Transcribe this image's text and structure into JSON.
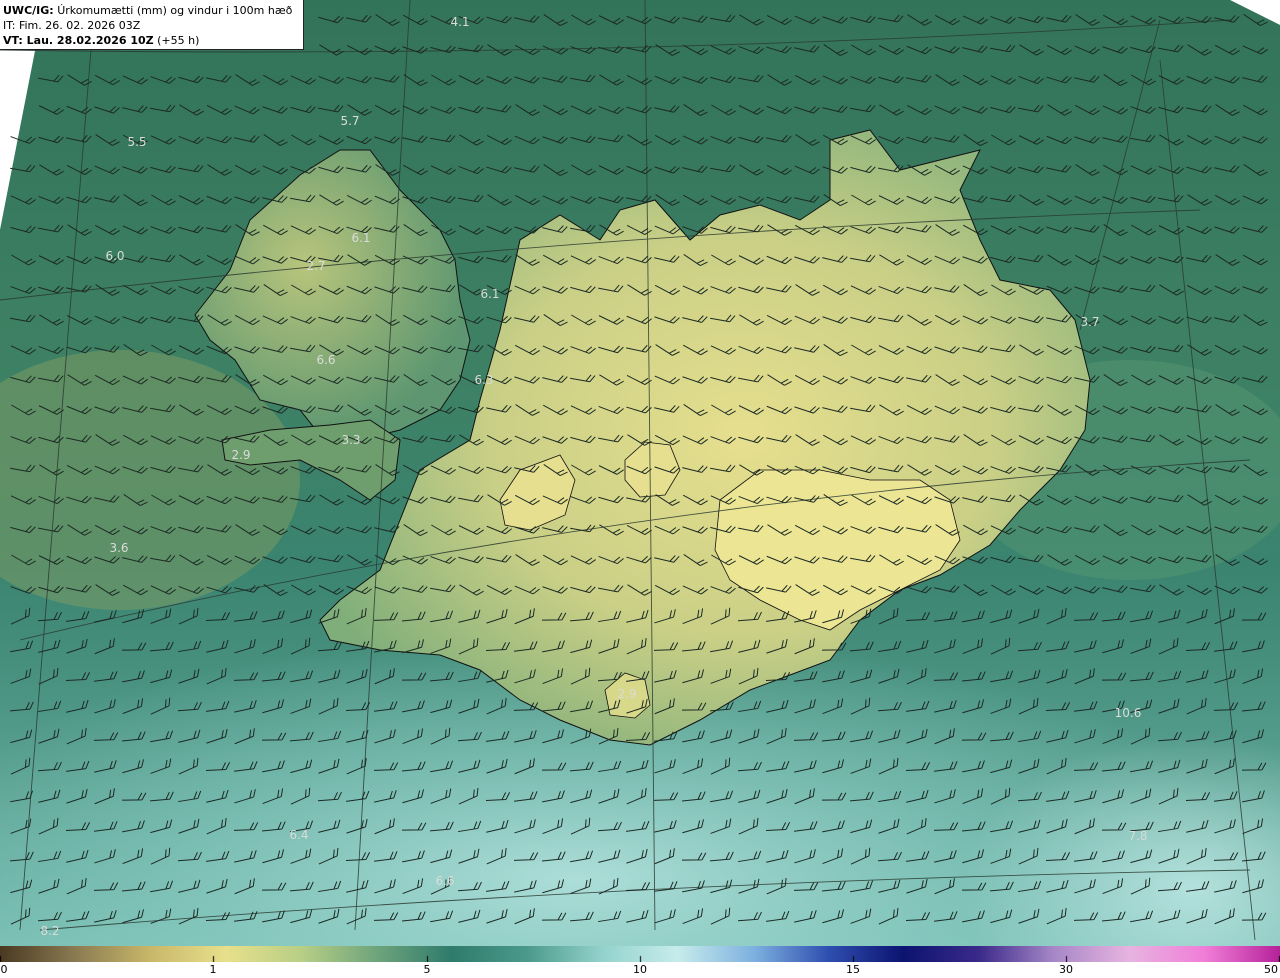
{
  "header": {
    "model_prefix": "UWC/IG:",
    "title": "Úrkomumætti (mm) og vindur i 100m hæð",
    "init_time": "IT: Fim. 26. 02. 2026 03Z",
    "valid_prefix": "VT: Lau. 28.02.2026 10Z",
    "valid_suffix": "(+55 h)"
  },
  "map_labels": [
    "4.1",
    "5.7",
    "5.5",
    "6.1",
    "6.0",
    "2.7",
    "6.1",
    "3.7",
    "6.6",
    "6.3",
    "3.3",
    "2.9",
    "3.6",
    "2.9",
    "10.6",
    "6.4",
    "7.8",
    "6.6",
    "8.2"
  ],
  "colorbar": {
    "ticks": [
      "0",
      "1",
      "5",
      "10",
      "15",
      "30",
      "50"
    ],
    "stops": [
      "#4a3a22",
      "#8b7b52",
      "#c9b86a",
      "#e8e08c",
      "#b8cf86",
      "#6fa57c",
      "#2f7b6c",
      "#4c9a8c",
      "#93d3cd",
      "#c7ecec",
      "#7fb2e0",
      "#2f4fb0",
      "#0c1470",
      "#3b2a8a",
      "#a788c8",
      "#e8b4e0",
      "#f07ed8",
      "#b6229a"
    ],
    "colors": {
      "land_high": "#e3de8c",
      "land_mid": "#a9c27e",
      "ocean": "#2f7d6f",
      "ocean_light": "#9ad7d0",
      "border": "#111111"
    }
  }
}
